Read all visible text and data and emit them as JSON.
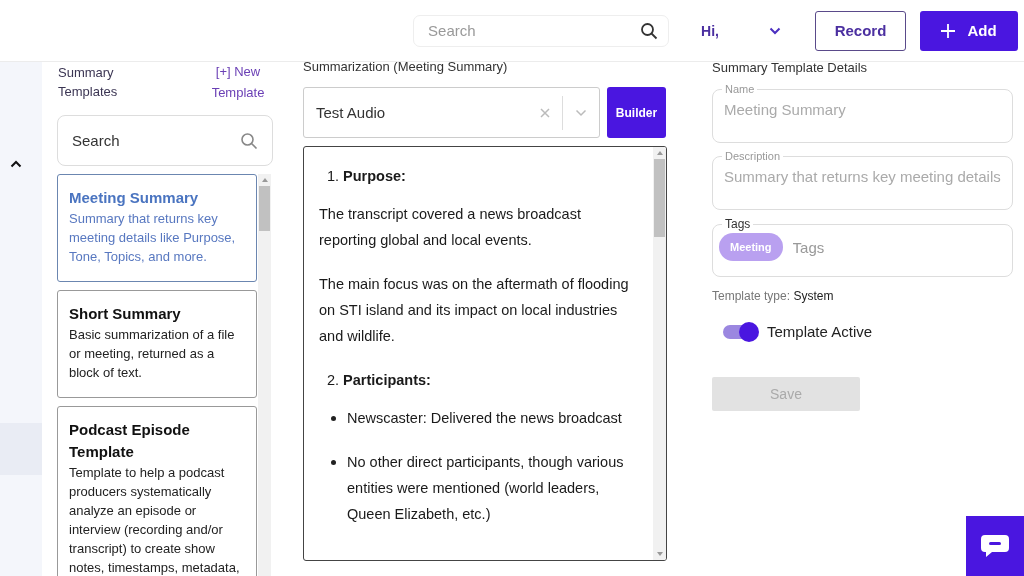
{
  "header": {
    "search": {
      "placeholder": "Search"
    },
    "greeting": "Hi,",
    "buttons": [
      {
        "kind": "outline",
        "label": "Record"
      },
      {
        "kind": "primary",
        "label": "Add"
      }
    ]
  },
  "templates_panel": {
    "title": "Summary Templates",
    "new_link": "[+] New Template",
    "search": {
      "placeholder": "Search"
    },
    "templates": [
      {
        "name": "Meeting Summary",
        "description": "Summary that returns key meeting details like Purpose, Tone, Topics, and more.",
        "selected": true
      },
      {
        "name": "Short Summary",
        "description": "Basic summarization of a file or meeting, returned as a block of text.",
        "selected": false
      },
      {
        "name": "Podcast Episode Template",
        "description": "Template to help a podcast producers systematically analyze an episode or interview (recording and/or transcript) to create show notes, timestamps, metadata,",
        "selected": false
      }
    ]
  },
  "summarization": {
    "title": "Summarization (Meeting Summary)",
    "source": "Test Audio",
    "builder_button": "Builder",
    "content": [
      {
        "kind": "heading",
        "number": "1.",
        "text": "Purpose:"
      },
      {
        "kind": "paragraph",
        "text": "The transcript covered a news broadcast reporting global and local events."
      },
      {
        "kind": "paragraph",
        "text": "The main focus was on the aftermath of flooding on STI island and its impact on local industries and wildlife."
      },
      {
        "kind": "heading",
        "number": "2.",
        "text": "Participants:"
      },
      {
        "kind": "bullet",
        "text": "Newscaster: Delivered the news broadcast"
      },
      {
        "kind": "bullet",
        "text": "No other direct participants, though various entities were mentioned (world leaders, Queen Elizabeth, etc.)"
      }
    ]
  },
  "details": {
    "title": "Summary Template Details",
    "disabled": true,
    "name": {
      "label": "Name",
      "value": "Meeting Summary"
    },
    "description": {
      "label": "Description",
      "value": "Summary that returns key meeting details"
    },
    "tags": {
      "label": "Tags",
      "chips": [
        "Meeting"
      ],
      "placeholder": "Tags"
    },
    "template_type": {
      "label": "Template type:",
      "value": "System"
    },
    "active_toggle": {
      "label": "Template Active",
      "on": true
    },
    "save_button": {
      "label": "Save",
      "disabled": true
    }
  }
}
